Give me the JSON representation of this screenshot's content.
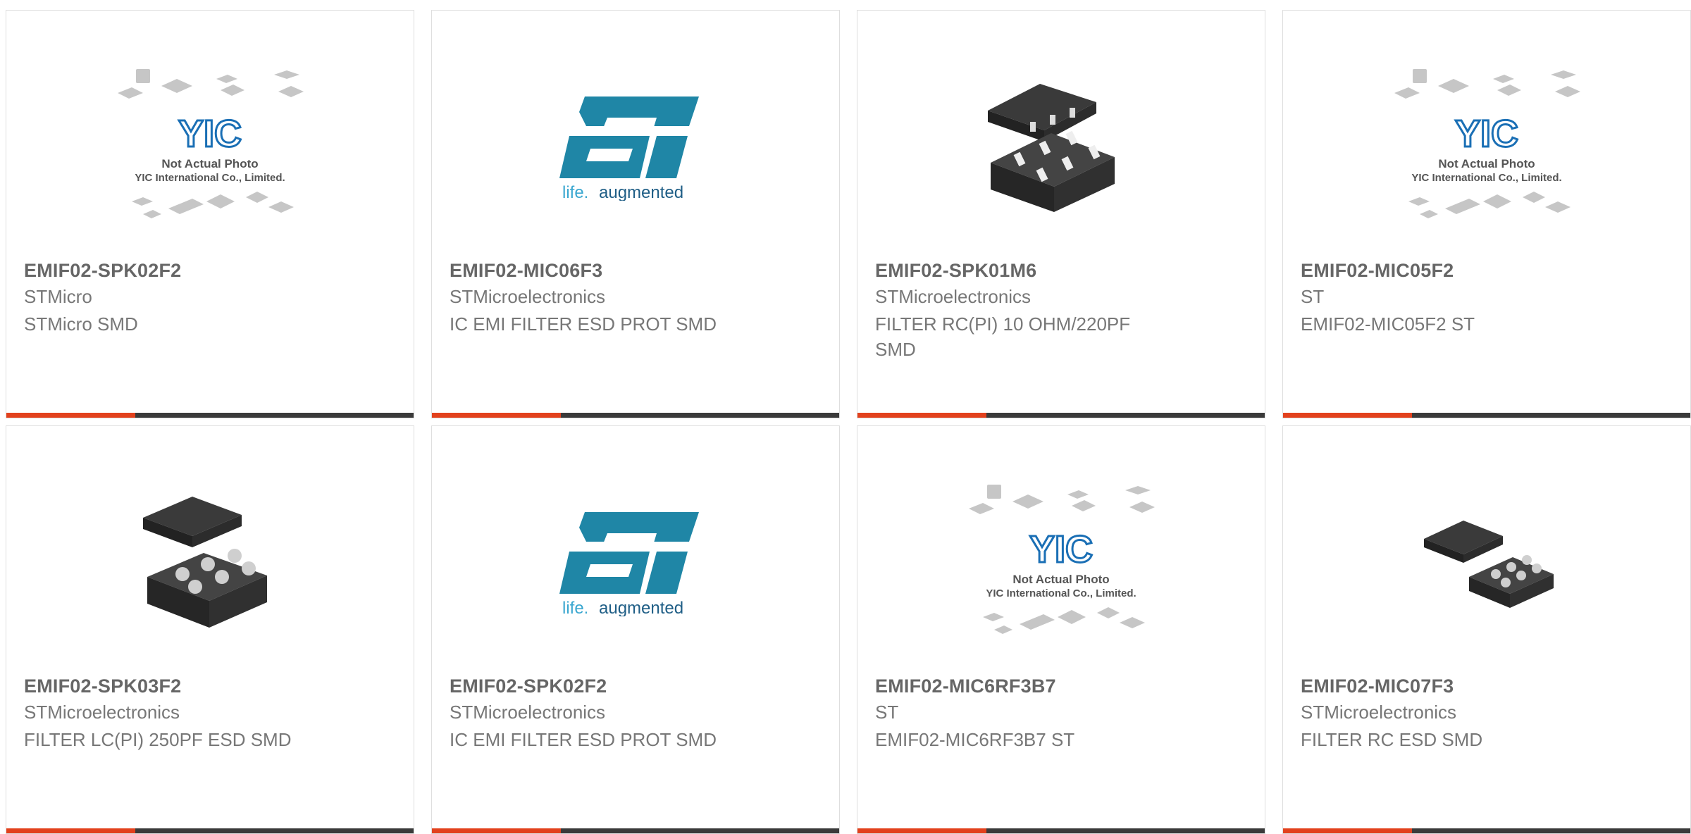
{
  "products": [
    {
      "part": "EMIF02-SPK02F2",
      "manufacturer": "STMicro",
      "description": "STMicro SMD",
      "image": "placeholder-not-actual-photo"
    },
    {
      "part": "EMIF02-MIC06F3",
      "manufacturer": "STMicroelectronics",
      "description": "IC EMI FILTER ESD PROT SMD",
      "image": "st-logo"
    },
    {
      "part": "EMIF02-SPK01M6",
      "manufacturer": "STMicroelectronics",
      "description": "FILTER RC(PI) 10 OHM/220PF SMD",
      "image": "dfn-chip-photo"
    },
    {
      "part": "EMIF02-MIC05F2",
      "manufacturer": "ST",
      "description": "EMIF02-MIC05F2 ST",
      "image": "placeholder-not-actual-photo"
    },
    {
      "part": "EMIF02-SPK03F2",
      "manufacturer": "STMicroelectronics",
      "description": "FILTER LC(PI) 250PF ESD SMD",
      "image": "bga-chip-photo"
    },
    {
      "part": "EMIF02-SPK02F2",
      "manufacturer": "STMicroelectronics",
      "description": "IC EMI FILTER ESD PROT SMD",
      "image": "st-logo"
    },
    {
      "part": "EMIF02-MIC6RF3B7",
      "manufacturer": "ST",
      "description": "EMIF02-MIC6RF3B7 ST",
      "image": "placeholder-not-actual-photo"
    },
    {
      "part": "EMIF02-MIC07F3",
      "manufacturer": "STMicroelectronics",
      "description": "FILTER RC ESD SMD",
      "image": "bga-chip-photo"
    }
  ],
  "placeholder": {
    "brand": "YIC",
    "line1": "Not Actual Photo",
    "line2": "YIC International Co., Limited."
  },
  "st_logo": {
    "mark": "ST",
    "tagline_a": "life.",
    "tagline_b": "augmented"
  },
  "colors": {
    "accent": "#e2411d",
    "bar": "#3a3a3a",
    "st_blue": "#1f86a6",
    "yic_blue": "#1a6fb5"
  }
}
